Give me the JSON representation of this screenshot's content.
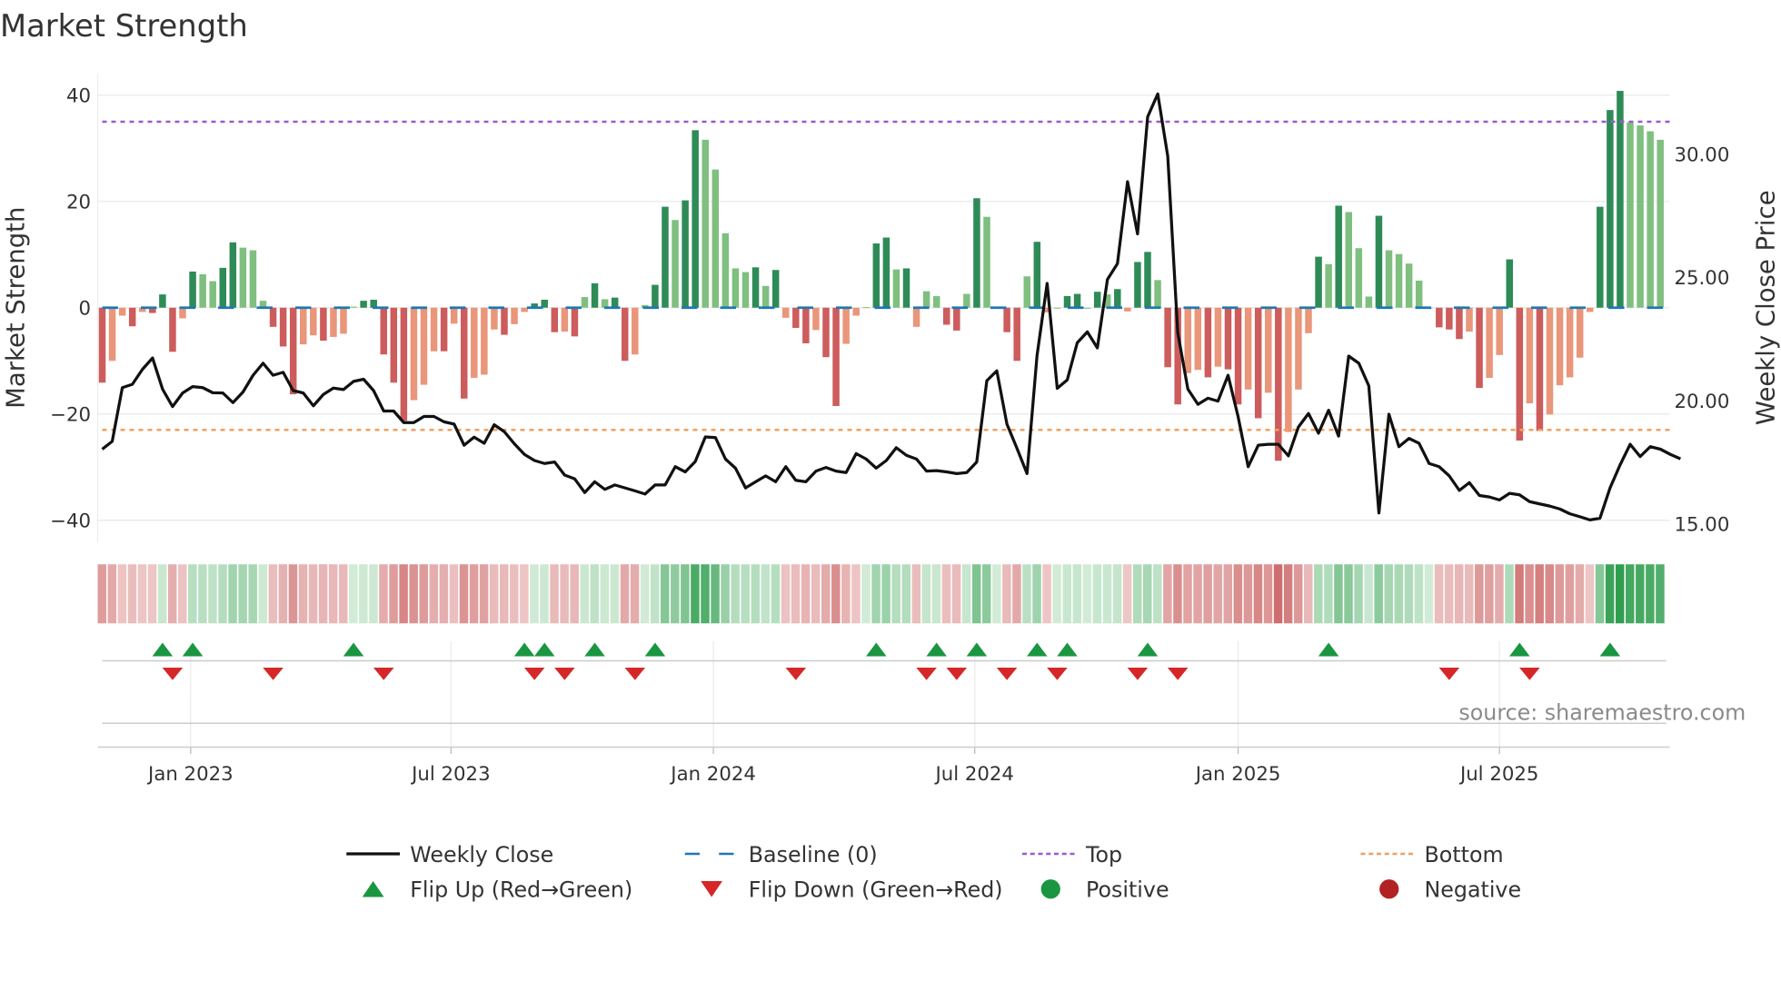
{
  "chart_data": {
    "type": "bar",
    "title": "Market Strength",
    "ylabel": "Market Strength",
    "y2label": "Weekly Close Price",
    "ylim": [
      -44,
      45
    ],
    "y2lim": [
      14.3,
      33.2
    ],
    "yticks": [
      40,
      20,
      0,
      -20,
      -40
    ],
    "ytick_labels": [
      "40",
      "20",
      "0",
      "−20",
      "−40"
    ],
    "y2ticks": [
      30,
      25,
      20,
      15
    ],
    "y2tick_labels": [
      "30.00",
      "25.00",
      "20.00",
      "15.00"
    ],
    "top_level": 35,
    "bottom_level": -23,
    "baseline": 0,
    "xticks": [
      {
        "week": 8.8,
        "label": "Jan 2023"
      },
      {
        "week": 34.7,
        "label": "Jul 2023"
      },
      {
        "week": 60.8,
        "label": "Jan 2024"
      },
      {
        "week": 86.8,
        "label": "Jul 2024"
      },
      {
        "week": 113,
        "label": "Jan 2025"
      },
      {
        "week": 139,
        "label": "Jul 2025"
      }
    ],
    "series": [
      {
        "name": "Market Strength",
        "type": "bar",
        "values": [
          -14.1,
          -10,
          -1.5,
          -3.5,
          -0.8,
          -1,
          2.5,
          -8.3,
          -2,
          6.8,
          6.3,
          5,
          7.5,
          12.3,
          11.3,
          10.8,
          1.3,
          -3.6,
          -7.3,
          -16.3,
          -6.9,
          -5.2,
          -6.2,
          -5.5,
          -4.9,
          0.2,
          1.3,
          1.5,
          -8.8,
          -14.1,
          -21.3,
          -17.4,
          -14.5,
          -8.2,
          -8.2,
          -3,
          -17.1,
          -13.2,
          -12.6,
          -4.1,
          -5.1,
          -3.1,
          -0.8,
          0.8,
          1.5,
          -4.6,
          -4.5,
          -5.4,
          2,
          4.6,
          1.6,
          1.9,
          -10,
          -8.8,
          0.5,
          4.3,
          19,
          16.5,
          20.2,
          33.4,
          31.6,
          26,
          14,
          7.4,
          6.7,
          7.6,
          4.1,
          7.1,
          -1.9,
          -3.8,
          -6.7,
          -4.2,
          -9.3,
          -18.5,
          -6.8,
          -1.5,
          0.1,
          12.1,
          13.2,
          7.2,
          7.4,
          -3.6,
          3.1,
          2.2,
          -3.2,
          -4.3,
          2.6,
          20.6,
          17.1,
          0,
          -4.6,
          -10,
          5.9,
          12.4,
          -0.9,
          0,
          2.2,
          2.6,
          0,
          3,
          2.5,
          3.5,
          -0.7,
          8.6,
          10.5,
          5.2,
          -11.2,
          -18.2,
          -12.3,
          -11.7,
          -13.1,
          -11.1,
          -11.6,
          -18.2,
          -15.4,
          -20.8,
          -16,
          -28.8,
          -23.4,
          -15.4,
          -4.8,
          9.6,
          8.2,
          19.2,
          18,
          11.2,
          2.1,
          17.3,
          10.8,
          10.1,
          8.3,
          5.1,
          0,
          -3.7,
          -4.1,
          -5.9,
          -4.5,
          -15.1,
          -13.2,
          -8.9,
          9.1,
          -25,
          -18,
          -23.2,
          -20.1,
          -14.6,
          -13.1,
          -9.4,
          -0.8,
          19,
          37.2,
          40.8,
          34.9,
          34.3,
          33.2,
          31.6
        ]
      },
      {
        "name": "Weekly Close",
        "type": "line",
        "axis": "right",
        "values": [
          17.99,
          18.31,
          20.49,
          20.62,
          21.23,
          21.69,
          20.43,
          19.72,
          20.27,
          20.53,
          20.49,
          20.28,
          20.27,
          19.88,
          20.31,
          20.99,
          21.48,
          20.99,
          21.11,
          20.37,
          20.27,
          19.75,
          20.21,
          20.47,
          20.41,
          20.74,
          20.83,
          20.37,
          19.54,
          19.54,
          19.07,
          19.07,
          19.32,
          19.32,
          19.1,
          19.01,
          18.15,
          18.48,
          18.23,
          18.98,
          18.7,
          18.21,
          17.78,
          17.53,
          17.41,
          17.47,
          16.94,
          16.79,
          16.23,
          16.67,
          16.36,
          16.54,
          16.42,
          16.3,
          16.17,
          16.54,
          16.54,
          17.28,
          17.07,
          17.49,
          18.49,
          18.46,
          17.59,
          17.22,
          16.42,
          16.67,
          16.91,
          16.67,
          17.28,
          16.73,
          16.67,
          17.1,
          17.25,
          17.1,
          17.04,
          17.81,
          17.59,
          17.22,
          17.53,
          18.05,
          17.74,
          17.59,
          17.1,
          17.12,
          17.07,
          17.0,
          17.04,
          17.47,
          20.77,
          21.17,
          19.01,
          18.02,
          17.0,
          21.79,
          24.72,
          20.46,
          20.8,
          22.31,
          22.75,
          22.1,
          24.88,
          25.52,
          28.85,
          26.73,
          31.48,
          32.41,
          29.88,
          22.72,
          20.43,
          19.81,
          20.06,
          19.94,
          20.99,
          19.32,
          17.28,
          18.15,
          18.19,
          18.19,
          17.72,
          18.89,
          19.44,
          18.64,
          19.57,
          18.52,
          21.77,
          21.48,
          20.56,
          15.4,
          19.41,
          18.09,
          18.43,
          18.23,
          17.41,
          17.28,
          16.91,
          16.32,
          16.63,
          16.11,
          16.05,
          15.93,
          16.2,
          16.14,
          15.86,
          15.77,
          15.68,
          15.56,
          15.37,
          15.25,
          15.12,
          15.19,
          16.42,
          17.35,
          18.19,
          17.69,
          18.09,
          17.99,
          17.78,
          17.6
        ]
      }
    ],
    "flip_up_weeks": [
      6,
      9,
      25,
      42,
      44,
      49,
      55,
      77,
      83,
      87,
      93,
      96,
      104,
      122,
      141,
      150
    ],
    "flip_down_weeks": [
      7,
      17,
      28,
      43,
      46,
      53,
      69,
      82,
      85,
      90,
      95,
      103,
      107,
      134,
      142
    ],
    "legend": {
      "position": "bottom",
      "items": [
        {
          "label": "Weekly Close",
          "kind": "line",
          "color": "#111111"
        },
        {
          "label": "Baseline (0)",
          "kind": "dash",
          "color": "#1f77b4"
        },
        {
          "label": "Top",
          "kind": "dot",
          "color": "#9b59d0"
        },
        {
          "label": "Bottom",
          "kind": "dot",
          "color": "#f0a060"
        },
        {
          "label": "Flip Up (Red→Green)",
          "kind": "up",
          "color": "#1a9641"
        },
        {
          "label": "Flip Down (Green→Red)",
          "kind": "down",
          "color": "#d62728"
        },
        {
          "label": "Positive",
          "kind": "circle",
          "color": "#1a9641"
        },
        {
          "label": "Negative",
          "kind": "circle",
          "color": "#b22222"
        }
      ]
    },
    "colors": {
      "pos_strong": "#2e8b57",
      "pos_weak": "#7fbf7f",
      "neg_strong": "#cd5c5c",
      "neg_weak": "#e9967a"
    },
    "source": "source: sharemaestro.com"
  }
}
